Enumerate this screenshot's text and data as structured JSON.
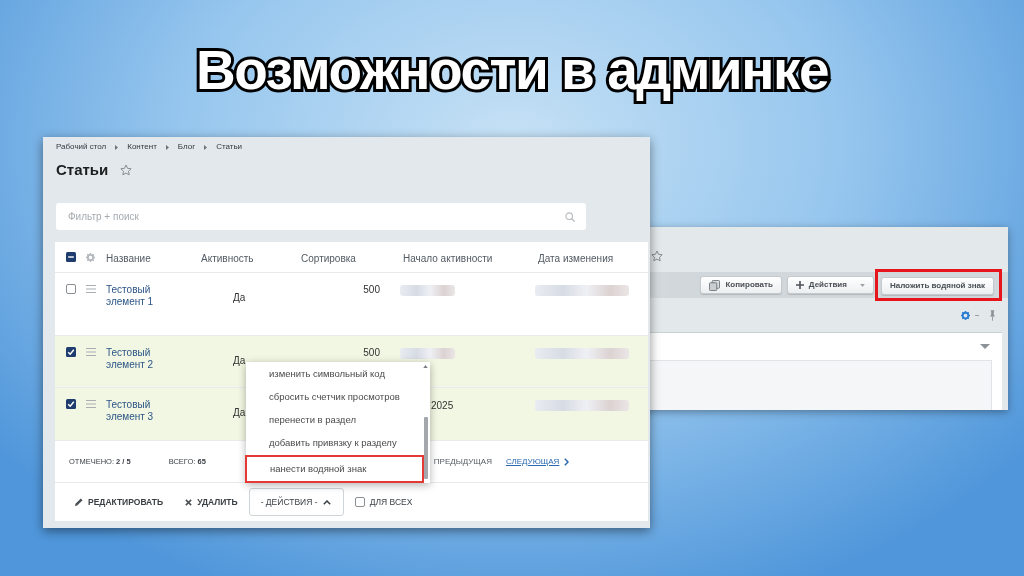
{
  "title": "Возможности в админке",
  "admin_list": {
    "breadcrumbs": [
      "Рабочий стол",
      "Контент",
      "Блог",
      "Статьи"
    ],
    "heading": "Статьи",
    "search": {
      "placeholder": "Фильтр + поиск"
    },
    "select_all": {
      "indeterminate": true
    },
    "columns": [
      "Название",
      "Активность",
      "Сортировка",
      "Начало активности",
      "Дата изменения"
    ],
    "rows": [
      {
        "checked": false,
        "name": "Тестовый элемент 1",
        "active": "Да",
        "sort": "500",
        "start": {
          "redacted": true
        },
        "changed": {
          "redacted": true
        }
      },
      {
        "checked": true,
        "name": "Тестовый элемент 2",
        "active": "Да",
        "sort": "500",
        "start": {
          "redacted": true
        },
        "changed": {
          "redacted": true
        }
      },
      {
        "checked": true,
        "name": "Тестовый элемент 3",
        "active": "Да",
        "start": {
          "redacted": false,
          "text": "2025"
        },
        "changed": {
          "redacted": true
        }
      }
    ],
    "footer": {
      "selected": "ОТМЕЧЕНО: **2 / 5**",
      "total": "ВСЕГО: **65**",
      "prev": "ПРЕДЫДУЩАЯ",
      "next": "СЛЕДУЮЩАЯ"
    },
    "actions": {
      "edit": "РЕДАКТИРОВАТЬ",
      "delete": "УДАЛИТЬ",
      "select": {
        "value": "- ДЕЙСТВИЯ -",
        "expanded": true
      },
      "for_all": {
        "label": "ДЛЯ ВСЕХ",
        "checked": false
      }
    },
    "dropdown_options": [
      {
        "label": "изменить символьный код",
        "highlighted": false
      },
      {
        "label": "сбросить счетчик просмотров",
        "highlighted": false
      },
      {
        "label": "перенести в раздел",
        "highlighted": false
      },
      {
        "label": "добавить привязку к разделу",
        "highlighted": false
      },
      {
        "label": "нанести водяной знак",
        "highlighted": true
      }
    ]
  },
  "detail_view": {
    "toolbar": [
      {
        "kind": "copy",
        "label": "Копировать",
        "highlighted": false
      },
      {
        "kind": "menu",
        "label": "Действия",
        "highlighted": false
      },
      {
        "kind": "plain",
        "label": "Наложить водяной знак",
        "highlighted": true
      }
    ]
  }
}
